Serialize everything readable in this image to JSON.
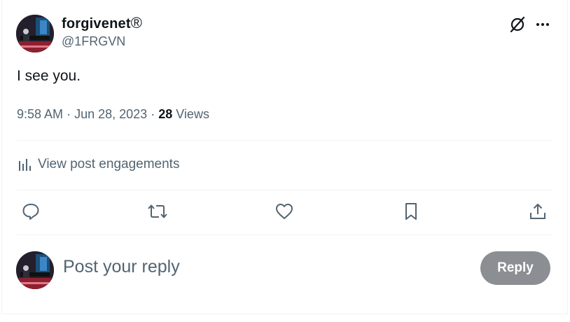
{
  "post": {
    "author": {
      "display_name": "forgivenet",
      "badge": "®",
      "handle": "@1FRGVN"
    },
    "text": "I see you.",
    "meta": {
      "time": "9:58 AM",
      "separator": "·",
      "date": "Jun 28, 2023",
      "views_count": "28",
      "views_label": "Views"
    },
    "engagements_label": "View post engagements",
    "actions": {
      "icons": [
        "reply-icon",
        "repost-icon",
        "like-icon",
        "bookmark-icon",
        "share-icon"
      ]
    }
  },
  "composer": {
    "placeholder": "Post your reply",
    "reply_button_label": "Reply"
  },
  "colors": {
    "text_primary": "#0f1419",
    "text_secondary": "#536471",
    "divider": "#eff3f4",
    "reply_button_disabled": "#8b8f93"
  }
}
